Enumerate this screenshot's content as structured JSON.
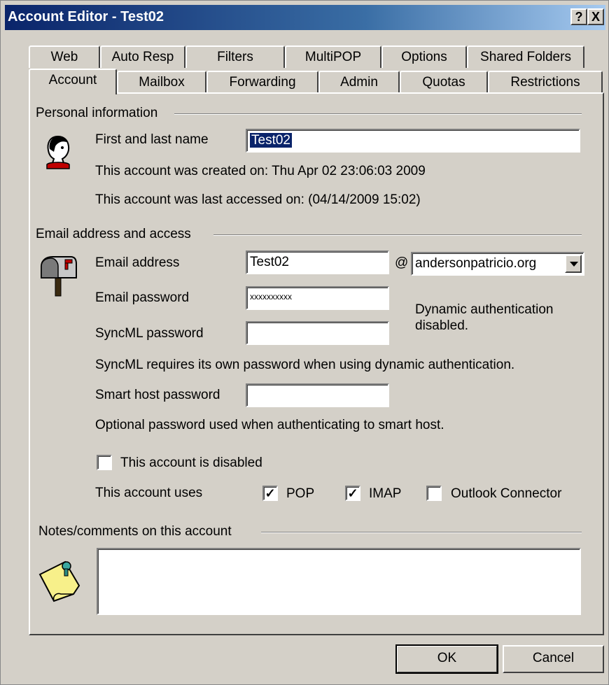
{
  "window": {
    "title": "Account Editor - Test02",
    "help_button": "?",
    "close_button": "X"
  },
  "tabs_row1": [
    "Web",
    "Auto Resp",
    "Filters",
    "MultiPOP",
    "Options",
    "Shared Folders"
  ],
  "tabs_row2": [
    "Account",
    "Mailbox",
    "Forwarding",
    "Admin",
    "Quotas",
    "Restrictions"
  ],
  "active_tab": "Account",
  "personal": {
    "group_label": "Personal information",
    "name_label": "First and last name",
    "name_value": "Test02",
    "created": "This account was created on: Thu Apr 02 23:06:03 2009",
    "accessed": "This account was last accessed on: (04/14/2009 15:02)"
  },
  "email": {
    "group_label": "Email address and access",
    "address_label": "Email address",
    "address_value": "Test02",
    "at": "@",
    "domain_value": "andersonpatricio.org",
    "password_label": "Email password",
    "password_value": "xxxxxxxxxx",
    "dynamic_auth": "Dynamic authentication disabled.",
    "syncml_label": "SyncML password",
    "syncml_value": "",
    "syncml_note": "SyncML requires its own password when using dynamic authentication.",
    "smarthost_label": "Smart host password",
    "smarthost_value": "",
    "smarthost_note": "Optional password used when authenticating to smart host.",
    "disabled_label": "This account is disabled",
    "disabled_checked": false,
    "uses_label": "This account uses",
    "pop_label": "POP",
    "pop_checked": true,
    "imap_label": "IMAP",
    "imap_checked": true,
    "outlook_label": "Outlook Connector",
    "outlook_checked": false
  },
  "notes": {
    "group_label": "Notes/comments on this account",
    "value": ""
  },
  "buttons": {
    "ok": "OK",
    "cancel": "Cancel"
  },
  "icons": {
    "person": "person-head-icon",
    "mailbox": "mailbox-icon",
    "note": "sticky-note-icon"
  },
  "colors": {
    "titlebar_start": "#0a246a",
    "face": "#d4d0c8",
    "selection": "#0a246a"
  }
}
